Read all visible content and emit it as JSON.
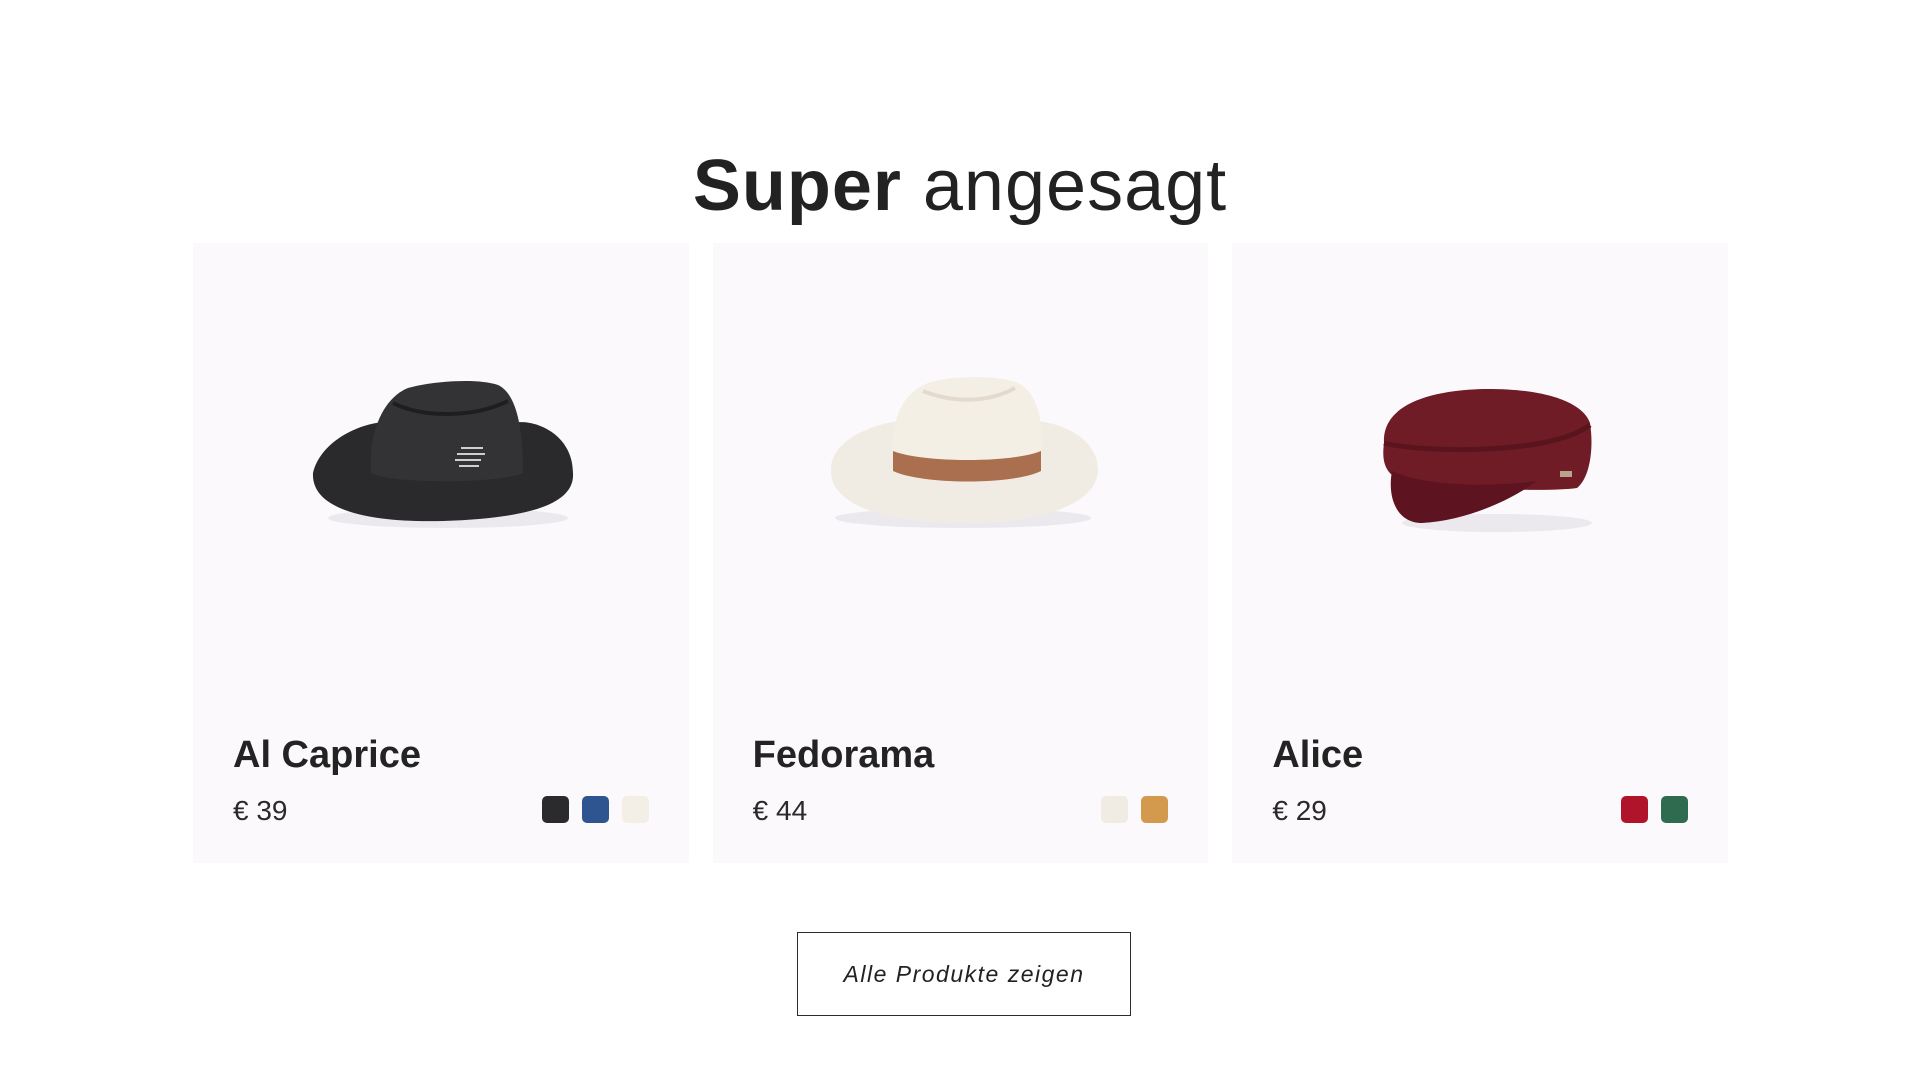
{
  "heading": {
    "bold": "Super",
    "light": "angesagt"
  },
  "products": [
    {
      "name": "Al Caprice",
      "price": "€ 39",
      "image_icon": "black-fedora-hat",
      "swatches": [
        "#2b2b2d",
        "#2f5590",
        "#f3efe7"
      ]
    },
    {
      "name": "Fedorama",
      "price": "€ 44",
      "image_icon": "cream-fedora-hat-brown-band",
      "swatches": [
        "#f1ece3",
        "#d39a4e"
      ]
    },
    {
      "name": "Alice",
      "price": "€ 29",
      "image_icon": "burgundy-sailor-cap",
      "swatches": [
        "#b0142a",
        "#2f6b4f"
      ]
    }
  ],
  "cta": {
    "label": "Alle Produkte zeigen"
  },
  "colors": {
    "card_bg": "#fbf9fc",
    "text": "#222222"
  }
}
